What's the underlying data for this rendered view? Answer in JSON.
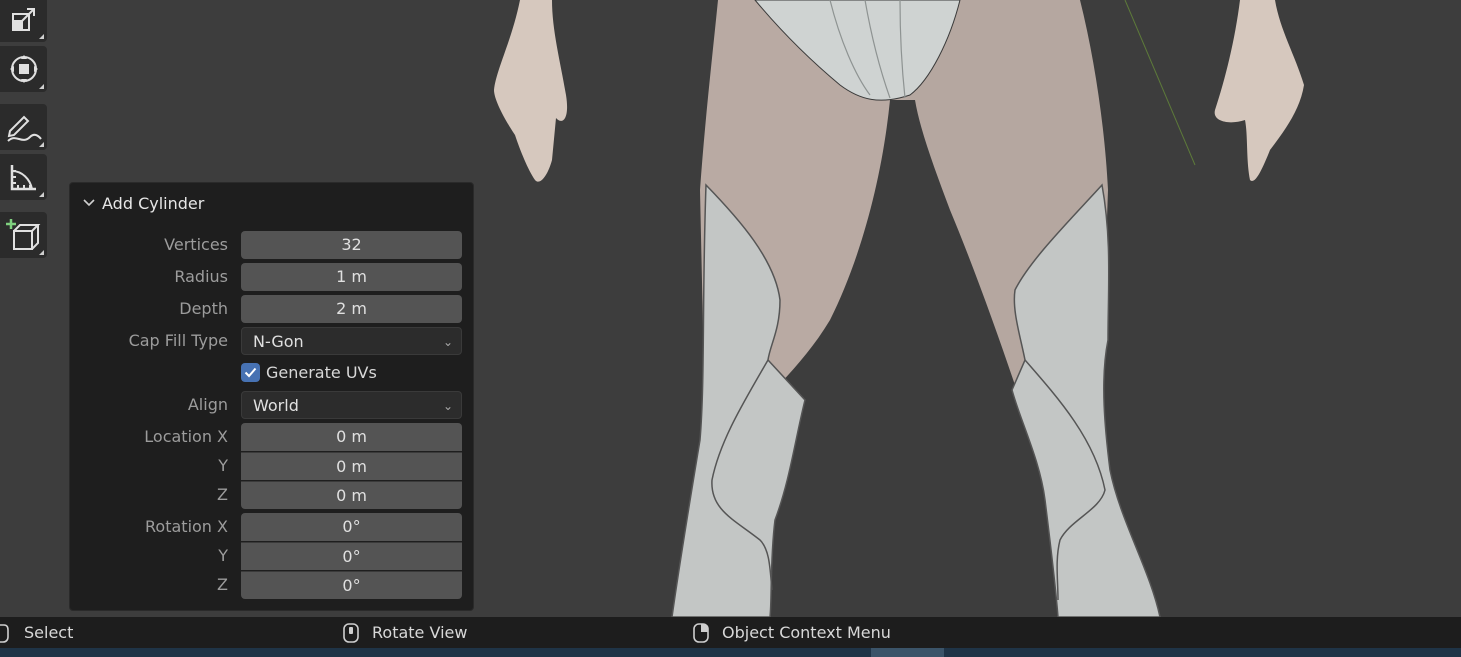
{
  "toolbar": {
    "tools": [
      {
        "name": "scale-tool",
        "icon": "scale-icon"
      },
      {
        "name": "transform-tool",
        "icon": "transform-icon"
      },
      {
        "name": "annotate-tool",
        "icon": "annotate-icon"
      },
      {
        "name": "measure-tool",
        "icon": "measure-icon"
      },
      {
        "name": "add-cube-tool",
        "icon": "add-cube-icon"
      }
    ]
  },
  "operator_panel": {
    "title": "Add Cylinder",
    "vertices_label": "Vertices",
    "vertices_value": "32",
    "radius_label": "Radius",
    "radius_value": "1 m",
    "depth_label": "Depth",
    "depth_value": "2 m",
    "cap_fill_label": "Cap Fill Type",
    "cap_fill_value": "N-Gon",
    "generate_uvs_label": "Generate UVs",
    "generate_uvs_checked": true,
    "align_label": "Align",
    "align_value": "World",
    "location_label": "Location X",
    "location_y_label": "Y",
    "location_z_label": "Z",
    "location_x": "0 m",
    "location_y": "0 m",
    "location_z": "0 m",
    "rotation_label": "Rotation X",
    "rotation_y_label": "Y",
    "rotation_z_label": "Z",
    "rotation_x": "0°",
    "rotation_y": "0°",
    "rotation_z": "0°"
  },
  "statusbar": {
    "select": "Select",
    "rotate_view": "Rotate View",
    "context_menu": "Object Context Menu"
  },
  "colors": {
    "viewport_bg": "#3d3d3d",
    "panel_bg": "#1e1e1e",
    "field_bg": "#545454",
    "checkbox_blue": "#4772b3",
    "statusbar_bg": "#1d1d1d"
  }
}
